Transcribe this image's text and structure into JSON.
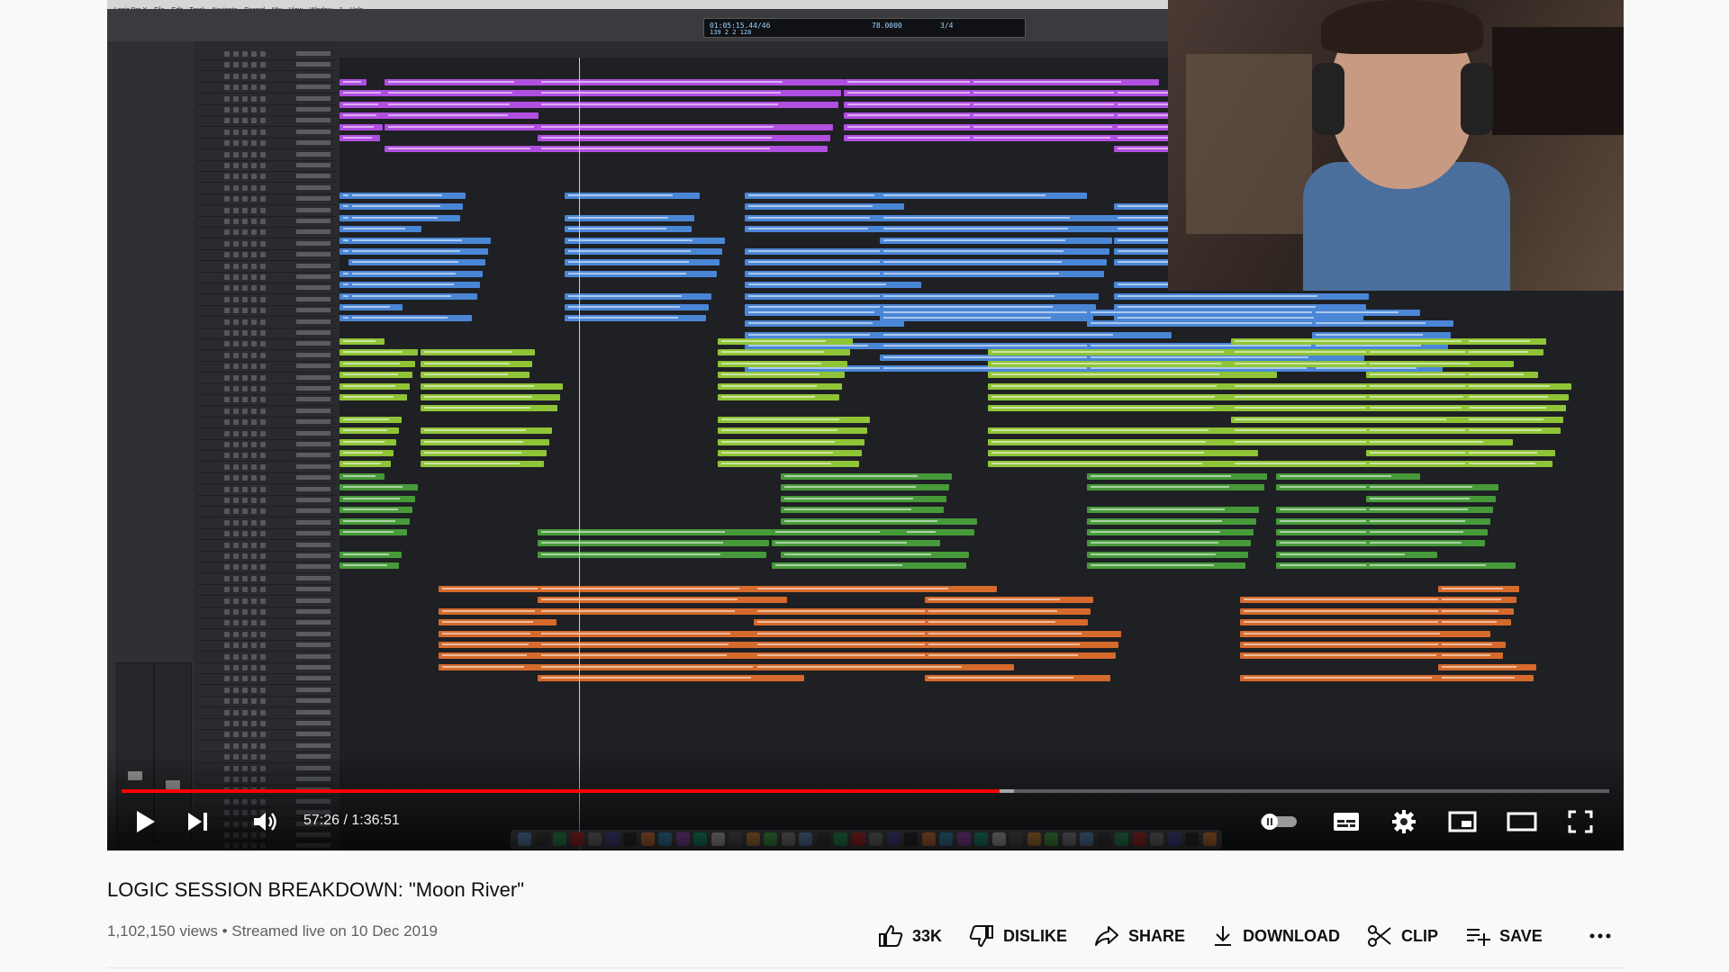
{
  "player": {
    "time_current": "57:26",
    "time_separator": " / ",
    "time_total": "1:36:51",
    "progress_fraction": 0.59,
    "buffered_fraction": 0.6,
    "colors": {
      "progress": "#ff0000"
    },
    "icons": {
      "play": "play-icon",
      "next": "next-icon",
      "volume": "volume-icon",
      "autoplay": "autoplay-toggle-icon",
      "subtitles": "subtitles-icon",
      "settings": "gear-icon",
      "miniplayer": "miniplayer-icon",
      "theater": "theater-mode-icon",
      "fullscreen": "fullscreen-icon"
    }
  },
  "video": {
    "title": "LOGIC SESSION BREAKDOWN: \"Moon River\"",
    "views": "1,102,150 views",
    "meta_separator": " • ",
    "streamed": "Streamed live on 10 Dec 2019"
  },
  "actions": {
    "like_count": "33K",
    "dislike_label": "DISLIKE",
    "share_label": "SHARE",
    "download_label": "DOWNLOAD",
    "clip_label": "CLIP",
    "save_label": "SAVE"
  },
  "logic": {
    "menubar": [
      "Logic Pro X",
      "File",
      "Edit",
      "Track",
      "Navigate",
      "Record",
      "Mix",
      "View",
      "Window",
      "1",
      "Help"
    ],
    "lcd_position": "01:05:15.44/46",
    "lcd_bars": "139 2 2 128",
    "lcd_tempo": "78.0000",
    "lcd_sig": "3/4",
    "region_colors": {
      "purple": "#b04fe0",
      "blue": "#4a86d6",
      "lime": "#8fc437",
      "green": "#479a3a",
      "orange": "#d56a2c"
    }
  }
}
